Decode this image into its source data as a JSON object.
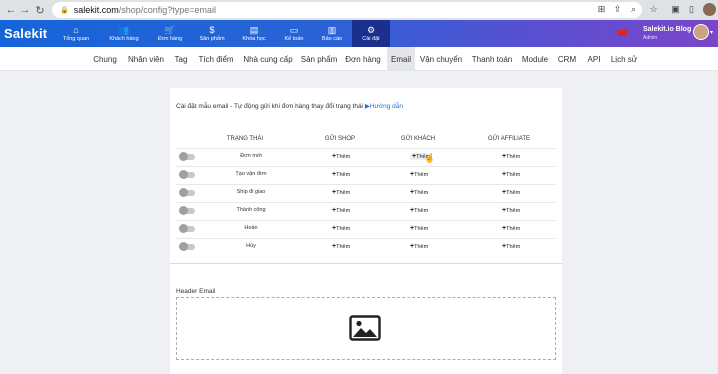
{
  "browser": {
    "url_host": "salekit.com",
    "url_path": "/shop/config?type=email"
  },
  "app": {
    "logo": "Salekit",
    "nav": [
      {
        "label": "Tổng quan",
        "icon": "home-icon"
      },
      {
        "label": "Khách hàng",
        "icon": "users-icon"
      },
      {
        "label": "Đơn hàng",
        "icon": "cart-icon"
      },
      {
        "label": "Sản phẩm",
        "icon": "dollar-icon"
      },
      {
        "label": "Khóa học",
        "icon": "book-icon"
      },
      {
        "label": "Kế toán",
        "icon": "wallet-icon"
      },
      {
        "label": "Báo cáo",
        "icon": "chart-icon"
      },
      {
        "label": "Cài đặt",
        "icon": "gear-icon"
      }
    ],
    "user": {
      "name": "Salekit.io Blog",
      "role": "Admin"
    }
  },
  "tabs": [
    "Chung",
    "Nhân viên",
    "Tag",
    "Tích điểm",
    "Nhà cung cấp",
    "Sản phẩm",
    "Đơn hàng",
    "Email",
    "Vận chuyển",
    "Thanh toán",
    "Module",
    "CRM",
    "API",
    "Lịch sử"
  ],
  "active_tab": "Email",
  "email_config": {
    "description": "Cài đặt mẫu email - Tự động gửi khi đơn hàng thay đổi trạng thái",
    "guide_link": "Hướng dẫn",
    "columns": [
      "TRẠNG THÁI",
      "GỬI SHOP",
      "GỬI KHÁCH",
      "GỬI AFFILIATE"
    ],
    "add_label": "Thêm",
    "rows": [
      {
        "status": "Đơn mới",
        "enabled": false
      },
      {
        "status": "Tạo vận đơn",
        "enabled": false
      },
      {
        "status": "Ship đi giao",
        "enabled": false
      },
      {
        "status": "Thành công",
        "enabled": false
      },
      {
        "status": "Hoàn",
        "enabled": false
      },
      {
        "status": "Hủy",
        "enabled": false
      }
    ],
    "header_email_label": "Header Email"
  },
  "colors": {
    "header_start": "#1565d8",
    "header_end": "#7b46c8",
    "active_nav": "#1b2f8e",
    "link": "#1e6fd9"
  }
}
